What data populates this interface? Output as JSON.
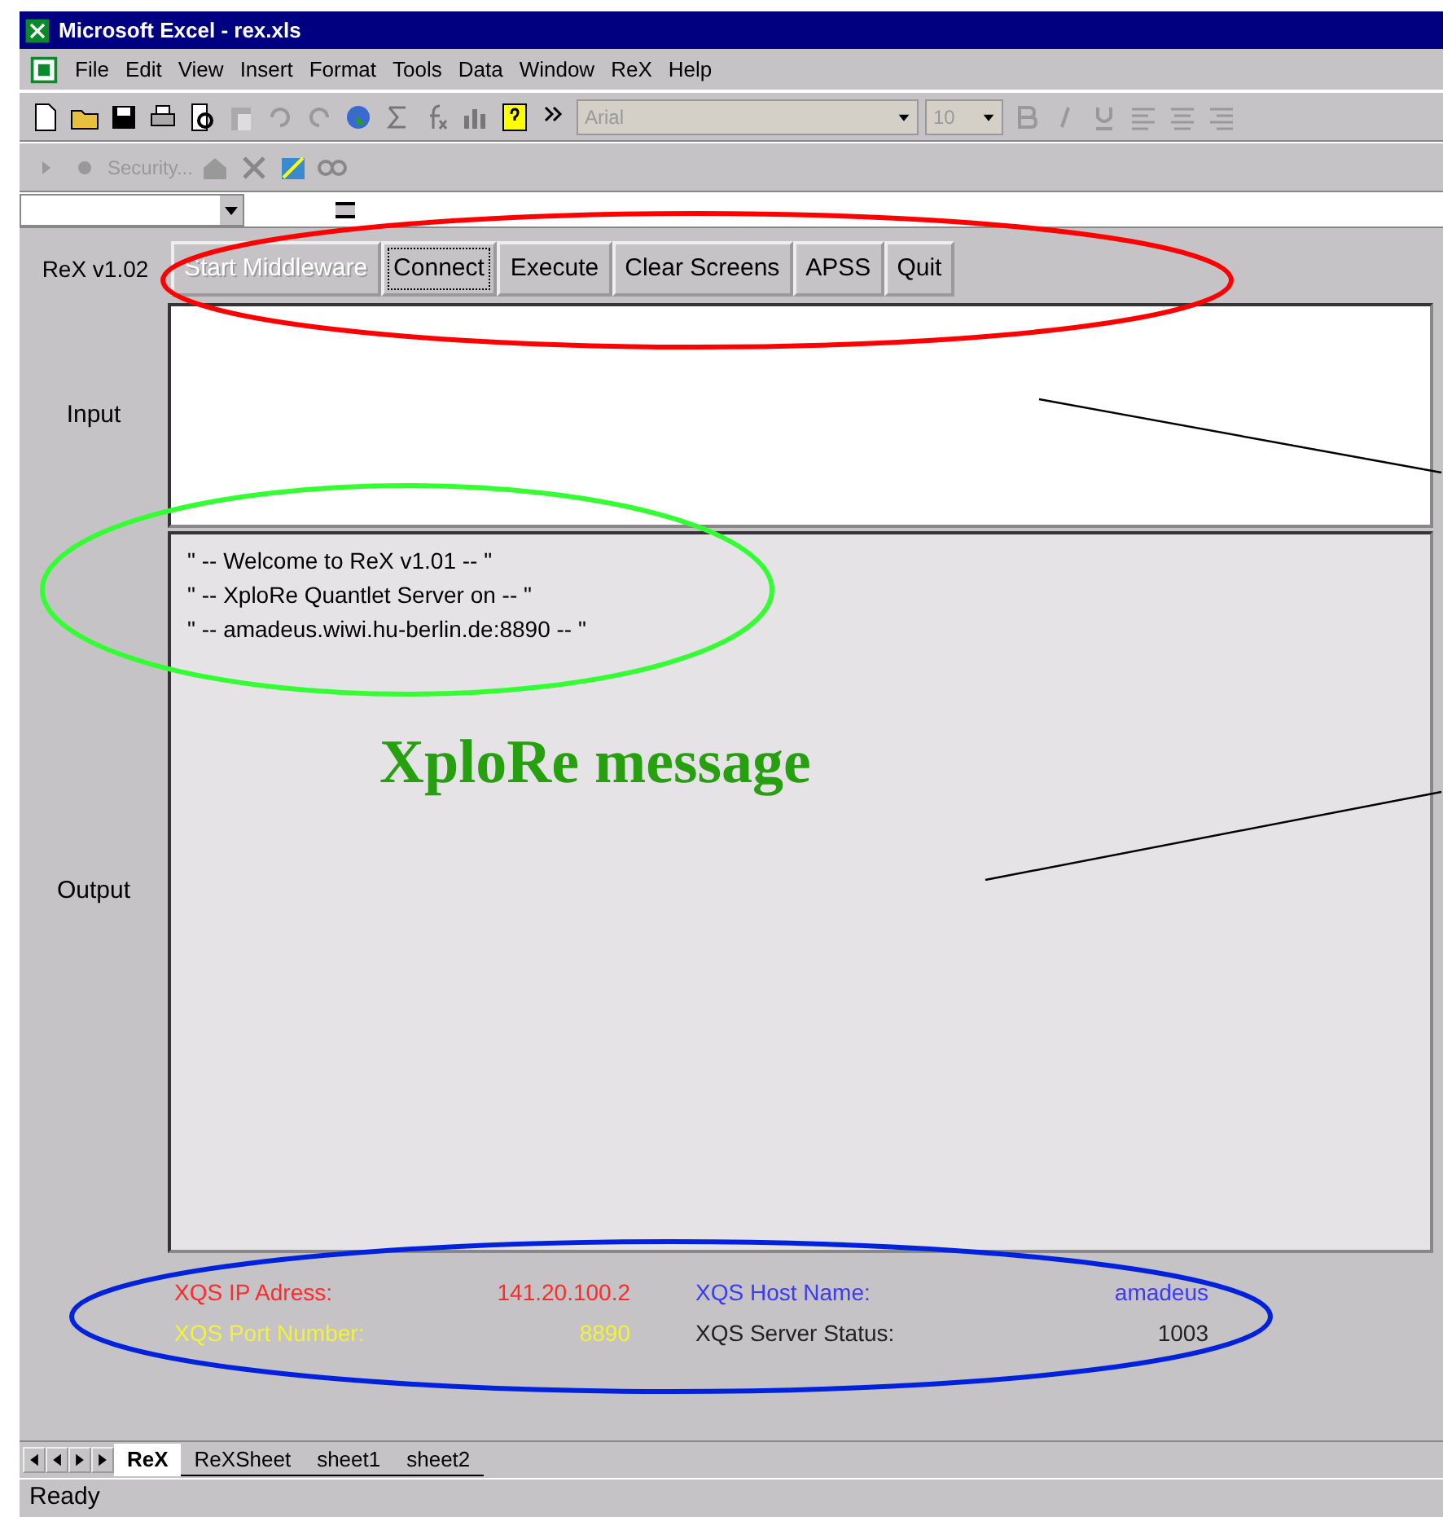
{
  "window": {
    "title": "Microsoft Excel - rex.xls"
  },
  "menu": [
    "File",
    "Edit",
    "View",
    "Insert",
    "Format",
    "Tools",
    "Data",
    "Window",
    "ReX",
    "Help"
  ],
  "toolbar": {
    "font": "Arial",
    "size": "10"
  },
  "toolbar2": {
    "security": "Security..."
  },
  "form": {
    "version": "ReX v1.02",
    "buttons": [
      {
        "label": "Start Middleware",
        "disabled": true,
        "focused": false
      },
      {
        "label": "Connect",
        "disabled": false,
        "focused": true
      },
      {
        "label": "Execute",
        "disabled": false,
        "focused": false
      },
      {
        "label": "Clear Screens",
        "disabled": false,
        "focused": false
      },
      {
        "label": "APSS",
        "disabled": false,
        "focused": false
      },
      {
        "label": "Quit",
        "disabled": false,
        "focused": false
      }
    ],
    "input_label": "Input",
    "output_label": "Output",
    "output_lines": [
      "\" -- Welcome to ReX v1.01 -- \"",
      "\" -- XploRe Quantlet Server on -- \"",
      "\" -- amadeus.wiwi.hu-berlin.de:8890 -- \""
    ]
  },
  "info": [
    {
      "label": "XQS IP Adress:",
      "value": "141.20.100.2",
      "color": "#ff2a2a"
    },
    {
      "label": "XQS Host Name:",
      "value": "amadeus",
      "color": "#3a3aff"
    },
    {
      "label": "XQS Port Number:",
      "value": "8890",
      "color": "#f2f23a"
    },
    {
      "label": "XQS Server Status:",
      "value": "1003",
      "color": "#222222"
    }
  ],
  "annotation": {
    "text": "XploRe message"
  },
  "sheet_tabs": [
    {
      "label": "ReX",
      "selected": true
    },
    {
      "label": "ReXSheet",
      "selected": false
    },
    {
      "label": "sheet1",
      "selected": false
    },
    {
      "label": "sheet2",
      "selected": false
    }
  ],
  "status_bar": "Ready"
}
